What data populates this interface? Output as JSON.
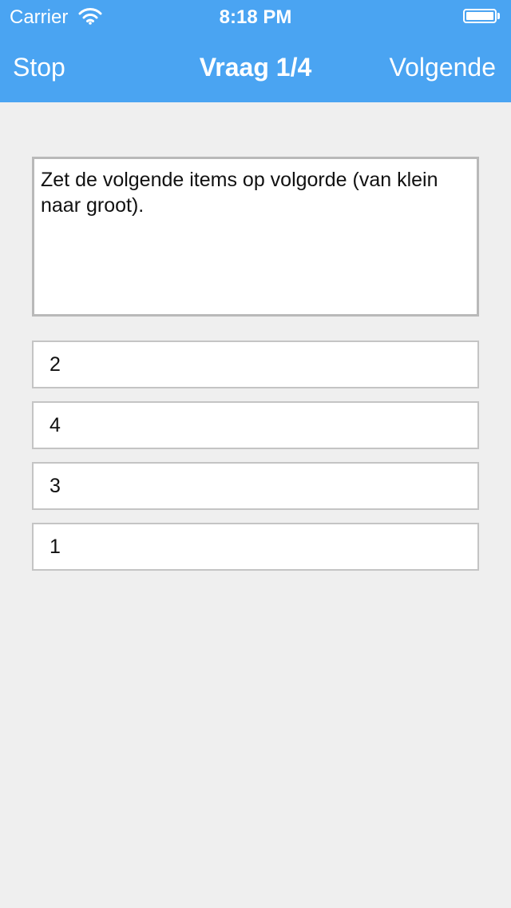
{
  "status_bar": {
    "carrier": "Carrier",
    "time": "8:18 PM",
    "wifi_icon": "wifi-icon",
    "battery_icon": "battery-icon"
  },
  "nav": {
    "left": "Stop",
    "title": "Vraag 1/4",
    "right": "Volgende"
  },
  "question": {
    "text": "Zet de volgende items op volgorde (van klein naar groot)."
  },
  "options": [
    "2",
    "4",
    "3",
    "1"
  ],
  "colors": {
    "nav_bar": "#4aa4f2",
    "background": "#efefef"
  }
}
